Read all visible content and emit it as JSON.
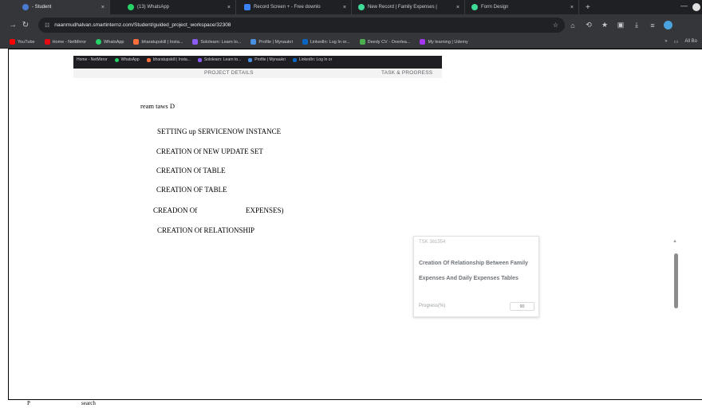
{
  "browser": {
    "tabs": [
      {
        "label": "- Student",
        "color": "#4a7bd0",
        "active": true
      },
      {
        "label": "(13) WhatsApp",
        "color": "#25d366"
      },
      {
        "label": "Record Screen + - Free downlo",
        "color": "#3b82f6"
      },
      {
        "label": "New Record | Family Expenses |",
        "color": "#3ddc97"
      },
      {
        "label": "Form Design",
        "color": "#3ddc97"
      }
    ],
    "tab_close_glyph": "×",
    "new_tab_glyph": "+",
    "minimize_glyph": "—",
    "url": "naanmudhalvan.smartinternz.com/Student/guided_project_workspace/32308",
    "bookmarks": [
      {
        "label": "YouTube",
        "color": "#ff0000"
      },
      {
        "label": "Home - NetMirror",
        "color": "#e50914"
      },
      {
        "label": "WhatsApp",
        "color": "#25d366"
      },
      {
        "label": "bharatupskill | Insta...",
        "color": "#ff6f3c"
      },
      {
        "label": "Sololearn: Learn to...",
        "color": "#8b5cf6"
      },
      {
        "label": "Profile | Mynaukri",
        "color": "#4a90e2"
      },
      {
        "label": "LinkedIn: Log In or...",
        "color": "#0a66c2"
      },
      {
        "label": "Deedy CV - Overlea...",
        "color": "#4caf50"
      },
      {
        "label": "My learning | Udemy",
        "color": "#a435f0"
      }
    ],
    "bookmarks_right": {
      "more": "»",
      "all": "All Bo"
    }
  },
  "inner_bookmarks": [
    {
      "label": "Home - NetMirror",
      "color": "#e50914"
    },
    {
      "label": "WhatsApp",
      "color": "#25d366"
    },
    {
      "label": "bharatupskill | Insta...",
      "color": "#ff6f3c"
    },
    {
      "label": "Sololearn: Learn to...",
      "color": "#8b5cf6"
    },
    {
      "label": "Profile | Mynaukri",
      "color": "#4a90e2"
    },
    {
      "label": "LinkedIn: Log In or",
      "color": "#0a66c2"
    }
  ],
  "inner_tabs": {
    "project_details": "PROJECT DETAILS",
    "task_progress": "TASK & PROGRESS"
  },
  "ocr_text": {
    "heading": "ream taws D",
    "items": [
      "SETTING up SERVICENOW INSTANCE",
      "CREATION Of NEW UPDATE SET",
      "CREATION Of TABLE",
      "CREATION OF TABLE"
    ],
    "item5_left": "CREADON Of",
    "item5_right": "EXPENSES)",
    "item6": "CREATION Of RELATIONSHIP"
  },
  "task_card": {
    "id": "TSK 381554",
    "title": "Creation Of Relationship Between Family Expenses And Daily Expenses Tables",
    "progress_label": "Progress(%)",
    "progress_value": "90"
  },
  "scroll": {
    "up_glyph": "▲"
  },
  "taskbar": {
    "left": "P",
    "search": "search"
  }
}
